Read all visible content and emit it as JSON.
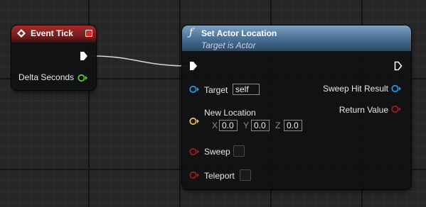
{
  "event_node": {
    "title": "Event Tick",
    "output_pin": "Delta Seconds",
    "colors": {
      "header": "#a62b2b",
      "pin": "#5ac83c"
    }
  },
  "function_node": {
    "title": "Set Actor Location",
    "subtitle": "Target is Actor",
    "icon": "function-icon",
    "target": {
      "label": "Target",
      "value": "self"
    },
    "new_location": {
      "label": "New Location",
      "x_label": "X",
      "x": "0.0",
      "y_label": "Y",
      "y": "0.0",
      "z_label": "Z",
      "z": "0.0"
    },
    "sweep": {
      "label": "Sweep",
      "checked": false
    },
    "teleport": {
      "label": "Teleport",
      "checked": false
    },
    "outputs": {
      "sweep_hit_result": "Sweep Hit Result",
      "return_value": "Return Value"
    },
    "colors": {
      "header": "#5a7fa3",
      "object_pin": "#1e9ae6",
      "vector_pin": "#f2c12e",
      "bool_pin": "#a31a1a"
    }
  }
}
